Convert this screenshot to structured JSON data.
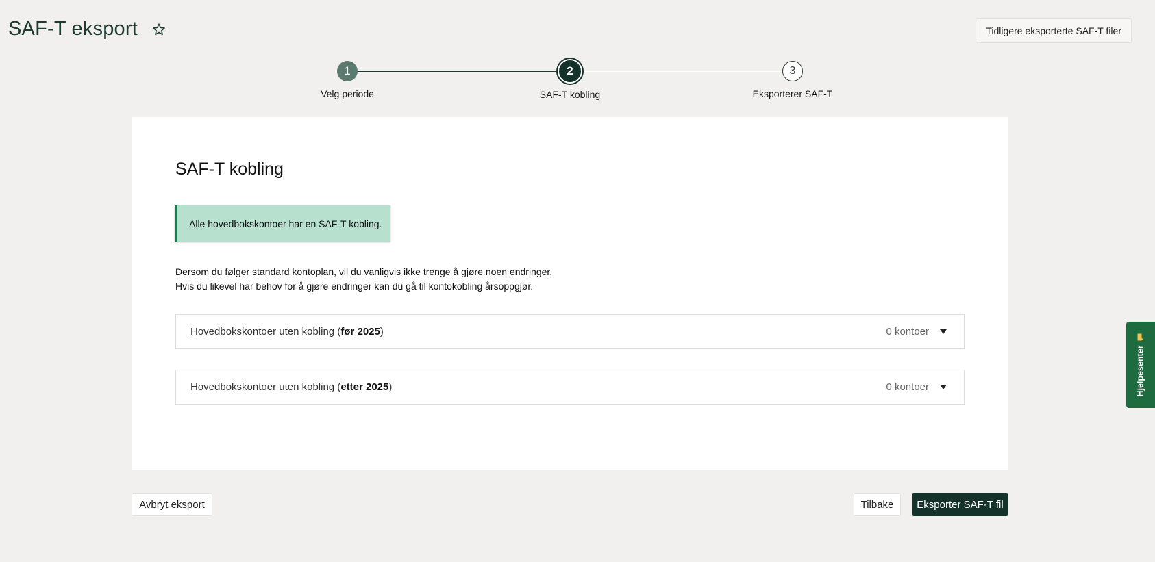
{
  "header": {
    "title": "SAF-T eksport",
    "favorite_icon": "star-outline-icon",
    "previous_exports_label": "Tidligere eksporterte SAF-T filer"
  },
  "stepper": {
    "steps": [
      {
        "number": "1",
        "label": "Velg periode",
        "state": "completed"
      },
      {
        "number": "2",
        "label": "SAF-T kobling",
        "state": "active"
      },
      {
        "number": "3",
        "label": "Eksporterer SAF-T",
        "state": "pending"
      }
    ]
  },
  "main": {
    "title": "SAF-T kobling",
    "alert": "Alle hovedbokskontoer har en SAF-T kobling.",
    "description_line1": "Dersom du følger standard kontoplan, vil du vanligvis ikke trenge å gjøre noen endringer.",
    "description_line2": "Hvis du likevel har behov for å gjøre endringer kan du gå til kontokobling årsoppgjør.",
    "accordions": [
      {
        "prefix": "Hovedbokskontoer uten kobling (",
        "bold": "før 2025",
        "suffix": ")",
        "count": "0 kontoer"
      },
      {
        "prefix": "Hovedbokskontoer uten kobling (",
        "bold": "etter 2025",
        "suffix": ")",
        "count": "0 kontoer"
      }
    ]
  },
  "footer": {
    "cancel_label": "Avbryt eksport",
    "back_label": "Tilbake",
    "export_label": "Eksporter SAF-T fil"
  },
  "help": {
    "label": "Hjelpesenter",
    "icon": "chat-bubble-icon"
  },
  "colors": {
    "primary": "#143229",
    "success_bg": "#b7e0cf",
    "success_border": "#1c7a4f",
    "help_tab": "#1e6b3f",
    "page_bg": "#f1f0ee"
  }
}
